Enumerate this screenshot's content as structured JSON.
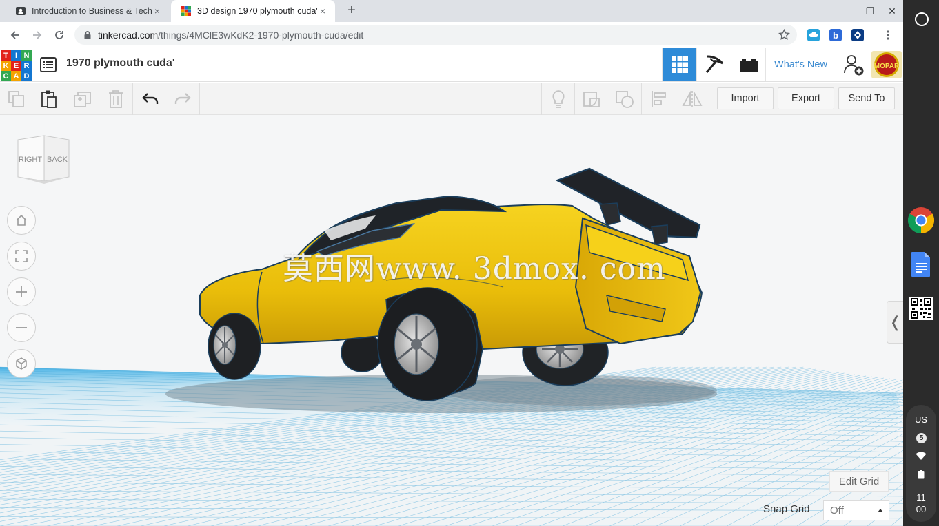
{
  "browser": {
    "tabs": [
      {
        "title": "Introduction to Business & Techn",
        "close": "×"
      },
      {
        "title": "3D design 1970 plymouth cuda' |",
        "close": "×"
      }
    ],
    "new_tab": "+",
    "window_controls": {
      "minimize": "–",
      "maximize": "❐",
      "close": "✕"
    },
    "url_host": "tinkercad.com",
    "url_path": "/things/4MClE3wKdK2-1970-plymouth-cuda/edit"
  },
  "app": {
    "logo_letters": [
      "T",
      "I",
      "N",
      "K",
      "E",
      "R",
      "C",
      "A",
      "D"
    ],
    "design_title": "1970 plymouth cuda'",
    "whats_new": "What's New",
    "avatar_text": "MOPAR"
  },
  "toolbar": {
    "import": "Import",
    "export": "Export",
    "send_to": "Send To"
  },
  "viewcube": {
    "left_face": "RIGHT",
    "right_face": "BACK"
  },
  "workplane": {
    "watermark": "莫西网www. 3dmox. com",
    "edit_grid": "Edit Grid",
    "snap_grid_label": "Snap Grid",
    "snap_grid_value": "Off",
    "collapse_glyph": "❬"
  },
  "shelf": {
    "ime": "US",
    "notification_count": "5",
    "clock_hour": "11",
    "clock_minute": "00"
  },
  "colors": {
    "accent": "#2e8bd8",
    "car_body": "#f2c510",
    "grid": "#4fb7e6"
  }
}
